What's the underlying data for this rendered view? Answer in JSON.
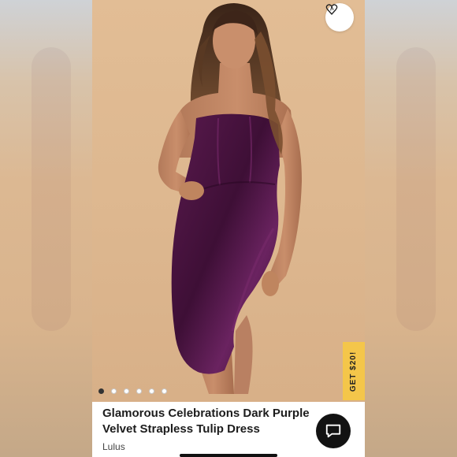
{
  "product": {
    "title_line1": "Glamorous Celebrations Dark Purple",
    "title_line2": "Velvet Strapless Tulip Dress",
    "brand": "Lulus"
  },
  "gallery": {
    "image_count": 6,
    "active_index": 0
  },
  "promo": {
    "label": "GET $20!"
  },
  "icons": {
    "favorite": "heart-icon",
    "chat": "chat-icon"
  },
  "colors": {
    "background": "#d9b690",
    "dress": "#4a1540",
    "promo": "#f4c64a",
    "chat_button": "#121212"
  }
}
